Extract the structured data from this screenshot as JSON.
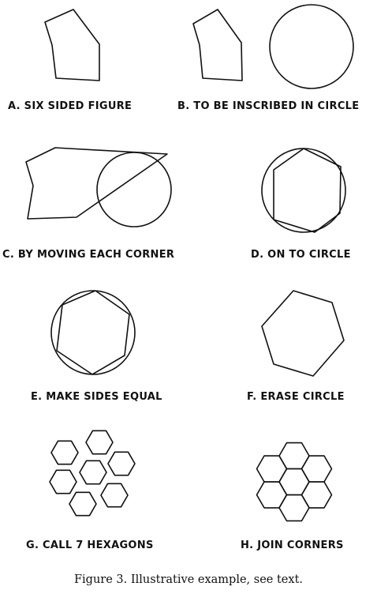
{
  "panels": [
    {
      "id": "a",
      "label": "A. SIX SIDED FIGURE"
    },
    {
      "id": "b",
      "label": "B. TO BE INSCRIBED IN CIRCLE"
    },
    {
      "id": "c",
      "label": "C. BY MOVING EACH CORNER"
    },
    {
      "id": "d",
      "label": "D. ON TO CIRCLE"
    },
    {
      "id": "e",
      "label": "E. MAKE SIDES EQUAL"
    },
    {
      "id": "f",
      "label": "F. ERASE CIRCLE"
    },
    {
      "id": "g",
      "label": "G. CALL 7 HEXAGONS"
    },
    {
      "id": "h",
      "label": "H. JOIN CORNERS"
    }
  ],
  "caption": "Figure 3.   Illustrative example, see text."
}
